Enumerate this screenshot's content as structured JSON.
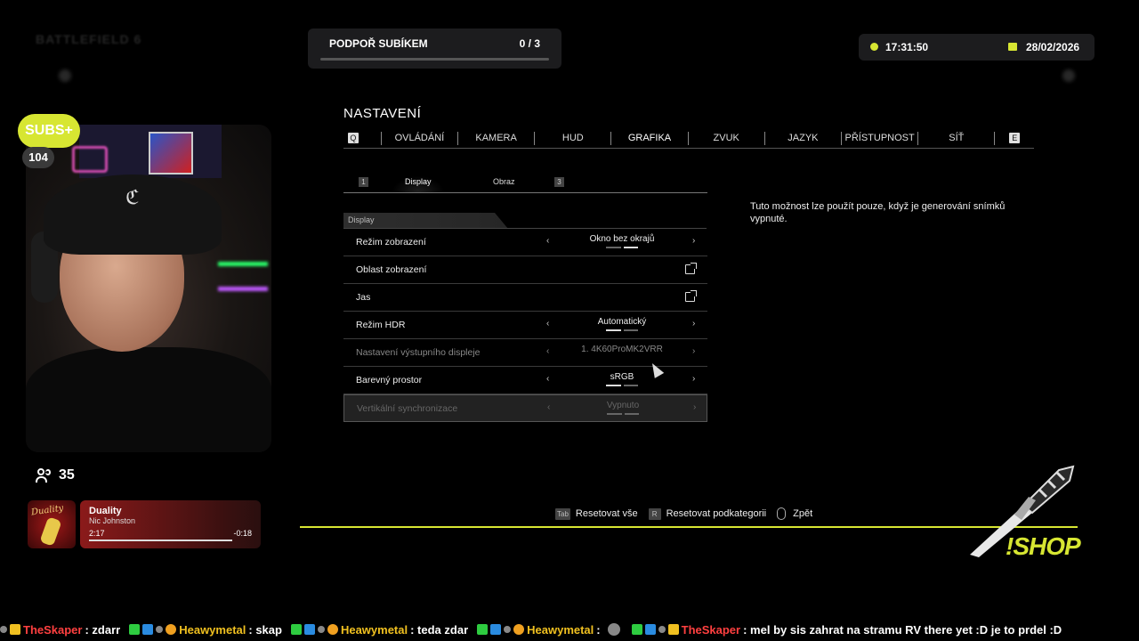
{
  "ghost": {
    "title": "BATTLEFIELD 6",
    "tabs": [
      "",
      "",
      "",
      "",
      "",
      "",
      "",
      "",
      ""
    ]
  },
  "sub_goal": {
    "label": "PODPOŘ SUBÍKEM",
    "count": "0 / 3",
    "progress": 0
  },
  "clock": {
    "time": "17:31:50",
    "date": "28/02/2026"
  },
  "settings": {
    "title": "NASTAVENÍ",
    "tab_key_left": "Q",
    "tab_key_right": "E",
    "tabs": [
      "OVLÁDÁNÍ",
      "KAMERA",
      "HUD",
      "GRAFIKA",
      "ZVUK",
      "JAZYK",
      "PŘÍSTUPNOST",
      "SÍŤ"
    ],
    "active_tab": "GRAFIKA",
    "subtab_key_left": "1",
    "subtab_key_right": "3",
    "subtabs": [
      "Display",
      "Obraz"
    ],
    "section": "Display",
    "rows": [
      {
        "name": "Režim zobrazení",
        "value": "Okno bez okrajů"
      },
      {
        "name": "Oblast zobrazení"
      },
      {
        "name": "Jas"
      },
      {
        "name": "Režim HDR",
        "value": "Automatický"
      },
      {
        "name": "Nastavení výstupního displeje",
        "value": "1. 4K60ProMK2VRR"
      },
      {
        "name": "Barevný prostor",
        "value": "sRGB"
      },
      {
        "name": "Vertikální synchronizace",
        "value": "Vypnuto"
      }
    ],
    "description": "Tuto možnost lze použít pouze, když je generování snímků vypnuté.",
    "hints": [
      {
        "key": "Tab",
        "label": "Resetovat vše"
      },
      {
        "key": "R",
        "label": "Resetovat podkategorii"
      },
      {
        "key": "",
        "label": "Zpět"
      }
    ]
  },
  "overlay": {
    "subs_label": "SUBS+",
    "subs_count": "104",
    "viewers": "35",
    "shop": "!SHOP"
  },
  "music": {
    "album_text": "Duality",
    "title": "Duality",
    "artist": "Nic Johnston",
    "current": "2:17",
    "remaining": "-0:18"
  },
  "chat": [
    {
      "user": "TheSkaper",
      "color": "#ff4040",
      "message": ": zdarr"
    },
    {
      "user": "Heawymetal",
      "color": "#f0c020",
      "message": ": skap"
    },
    {
      "user": "Heawymetal",
      "color": "#f0c020",
      "message": ": teda zdar"
    },
    {
      "user": "Heawymetal",
      "color": "#f0c020",
      "message": ":"
    },
    {
      "user": "TheSkaper",
      "color": "#ff4040",
      "message": ": mel by sis zahrat na stramu RV there yet :D je to prdel :D"
    }
  ],
  "colors": {
    "accent": "#d7e632",
    "background": "#000000"
  }
}
